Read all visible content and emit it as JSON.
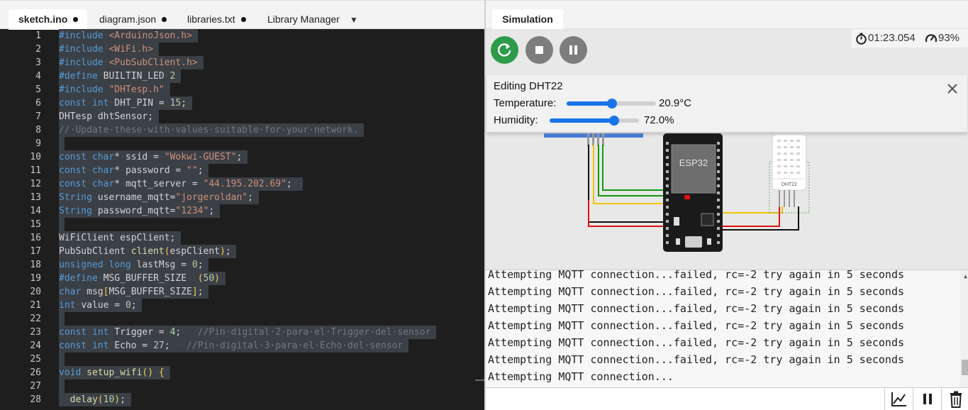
{
  "editor": {
    "tabs": [
      {
        "label": "sketch.ino",
        "modified": true
      },
      {
        "label": "diagram.json",
        "modified": true
      },
      {
        "label": "libraries.txt",
        "modified": true
      },
      {
        "label": "Library Manager",
        "modified": false
      }
    ],
    "line_numbers": [
      "1",
      "2",
      "3",
      "4",
      "5",
      "6",
      "7",
      "8",
      "9",
      "10",
      "11",
      "12",
      "13",
      "14",
      "15",
      "16",
      "17",
      "18",
      "19",
      "20",
      "21",
      "22",
      "23",
      "24",
      "25",
      "26",
      "27",
      "28"
    ]
  },
  "simulation": {
    "tab_label": "Simulation",
    "elapsed_time": "01:23.054",
    "speed": "93%",
    "controls": [
      "restart-icon",
      "stop-icon",
      "pause-icon"
    ],
    "editing_panel": {
      "title": "Editing DHT22",
      "temperature_label": "Temperature:",
      "temperature_value": "20.9°C",
      "temperature_fraction": 0.51,
      "humidity_label": "Humidity:",
      "humidity_value": "72.0%",
      "humidity_fraction": 0.72
    },
    "circuit": {
      "mcu_label": "ESP32",
      "sensor_label": "DHT22",
      "wire_colors": {
        "power": "#e01010",
        "ground": "#111111",
        "data": "#f2c400",
        "signal": "#119911"
      }
    },
    "serial_monitor": {
      "lines": [
        "Attempting MQTT connection...failed, rc=-2 try again in 5 seconds",
        "Attempting MQTT connection...failed, rc=-2 try again in 5 seconds",
        "Attempting MQTT connection...failed, rc=-2 try again in 5 seconds",
        "Attempting MQTT connection...failed, rc=-2 try again in 5 seconds",
        "Attempting MQTT connection...failed, rc=-2 try again in 5 seconds",
        "Attempting MQTT connection...failed, rc=-2 try again in 5 seconds",
        "Attempting MQTT connection..."
      ],
      "toolbar": [
        "plotter-icon",
        "pause-icon",
        "trash-icon"
      ]
    }
  },
  "colors": {
    "accent_blue": "#1a73e8",
    "run_green": "#2e9b4a",
    "editor_bg": "#1e1e1e"
  }
}
